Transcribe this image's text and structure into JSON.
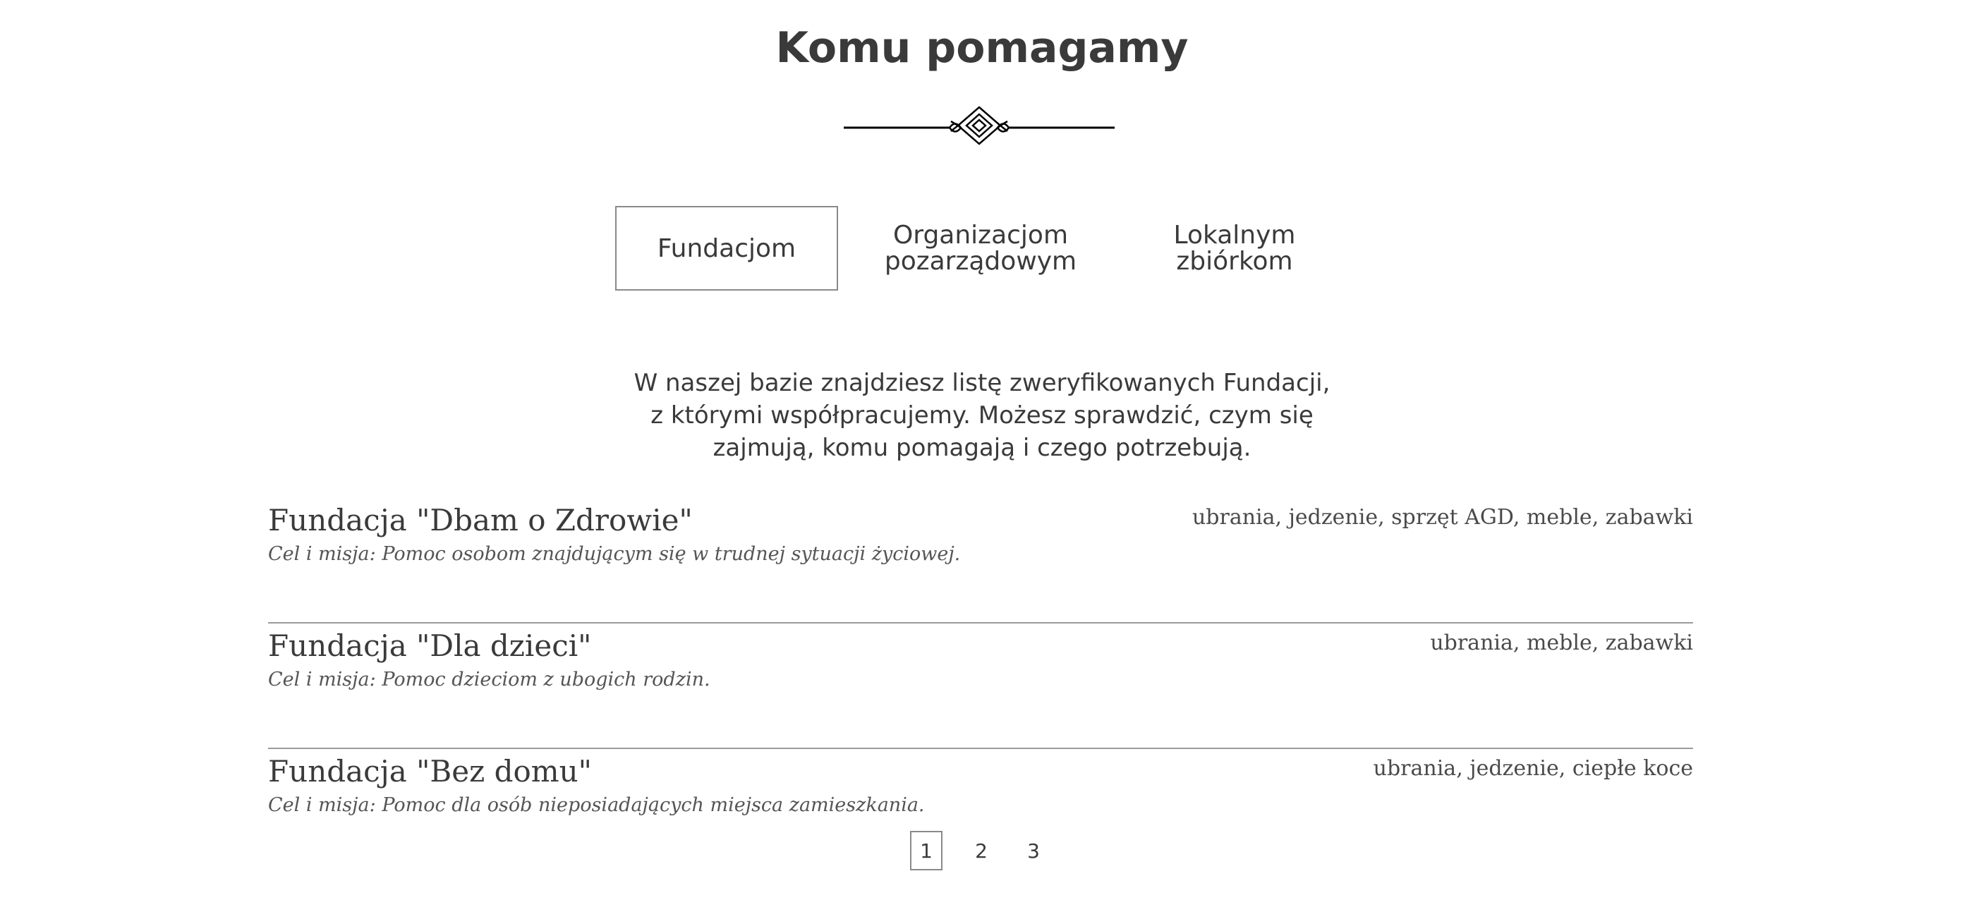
{
  "section": {
    "title": "Komu pomagamy"
  },
  "tabs": [
    {
      "label": "Fundacjom",
      "active": true
    },
    {
      "label": "Organizacjom\npozarządowym",
      "active": false
    },
    {
      "label": "Lokalnym\nzbiórkom",
      "active": false
    }
  ],
  "intro": "W naszej bazie znajdziesz listę zweryfikowanych Fundacji, z którymi współpracujemy. Możesz sprawdzić, czym się zajmują, komu pomagają i czego potrzebują.",
  "foundations": [
    {
      "name": "Fundacja \"Dbam o Zdrowie\"",
      "mission": "Cel i misja: Pomoc osobom znajdującym się w trudnej sytuacji życiowej.",
      "tags": "ubrania, jedzenie, sprzęt AGD, meble, zabawki"
    },
    {
      "name": "Fundacja \"Dla dzieci\"",
      "mission": "Cel i misja: Pomoc dzieciom z ubogich rodzin.",
      "tags": "ubrania, meble, zabawki"
    },
    {
      "name": "Fundacja \"Bez domu\"",
      "mission": "Cel i misja: Pomoc dla osób nieposiadających miejsca zamieszkania.",
      "tags": "ubrania, jedzenie, ciepłe koce"
    }
  ],
  "pagination": {
    "pages": [
      "1",
      "2",
      "3"
    ],
    "current": "1"
  },
  "icons": {
    "ornament": "decorative-divider-icon"
  },
  "colors": {
    "text": "#3a3a3a",
    "border": "#8a8a8a",
    "background": "#ffffff"
  }
}
